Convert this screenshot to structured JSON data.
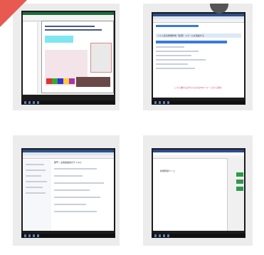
{
  "cards": [
    {
      "name": "card-excel-form",
      "description_text": ""
    },
    {
      "name": "card-web-form",
      "title_text": "リスト名の新規作成（任意）フォームを追加する",
      "bottom_banner": "こちら書き込まれたものはWebフォームから送信"
    },
    {
      "name": "card-chat-app",
      "header_text": "部門・全員連絡用のチャネル"
    },
    {
      "name": "card-word-doc",
      "doc_text": "新規登録ページ"
    }
  ],
  "overlay": {
    "color_arrow": "#e85a4f",
    "color_circle": "#555555"
  }
}
